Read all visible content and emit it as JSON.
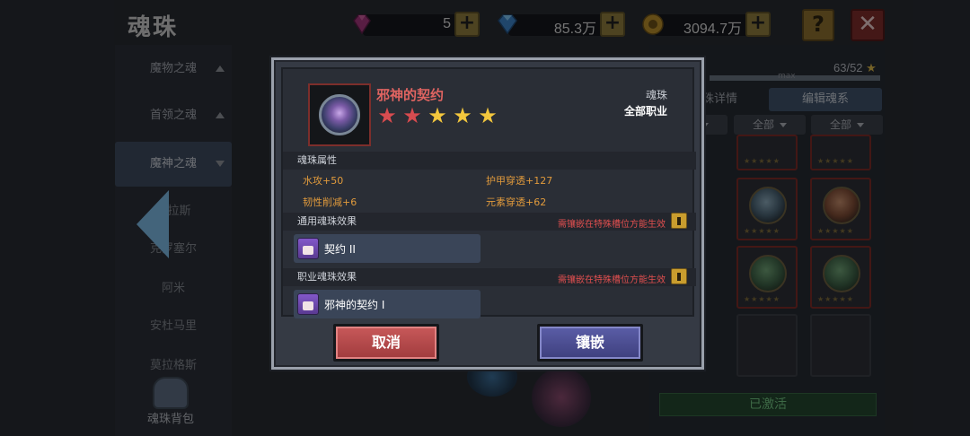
{
  "page": {
    "title": "魂珠"
  },
  "resources": [
    {
      "icon": "purple-gem-icon",
      "value": "5"
    },
    {
      "icon": "blue-diamond-icon",
      "value": "85.3万"
    },
    {
      "icon": "gold-coin-icon",
      "value": "3094.7万"
    }
  ],
  "top_buttons": {
    "help": "?",
    "close": "✕"
  },
  "sidebar": {
    "items": [
      {
        "label": "魔物之魂"
      },
      {
        "label": "首领之魂"
      },
      {
        "label": "魔神之魂"
      }
    ],
    "sub_items": [
      "阿拉斯",
      "克罗塞尔",
      "阿米",
      "安杜马里",
      "莫拉格斯"
    ],
    "bag_label": "魂珠背包"
  },
  "right_panel": {
    "count": "63/52",
    "max_label": "max",
    "tabs": [
      "魂珠详情",
      "编辑魂系"
    ],
    "filters": [
      "全部",
      "全部",
      "全部"
    ],
    "activated_label": "已激活"
  },
  "dialog": {
    "item_name": "邪神的契约",
    "rating": {
      "total": 5,
      "red": 2,
      "gold": 3
    },
    "type": "魂珠",
    "job": "全部职业",
    "attributes_title": "魂珠属性",
    "attributes": [
      {
        "text": "水攻+50"
      },
      {
        "text": "护甲穿透+127"
      },
      {
        "text": "韧性削减+6"
      },
      {
        "text": "元素穿透+62"
      }
    ],
    "general_effect_title": "通用魂珠效果",
    "general_effect_req": "需镶嵌在特殊槽位方能生效",
    "general_effect": "契约 II",
    "job_effect_title": "职业魂珠效果",
    "job_effect_req": "需镶嵌在特殊槽位方能生效",
    "job_effect": "邪神的契约 I",
    "cancel_label": "取消",
    "embed_label": "镶嵌"
  },
  "colors": {
    "item_name": "#e06461",
    "attribute": "#e09a3c",
    "requirement": "#e14f4f",
    "cancel_button": "#b74a4b",
    "embed_button": "#4d4f93"
  }
}
